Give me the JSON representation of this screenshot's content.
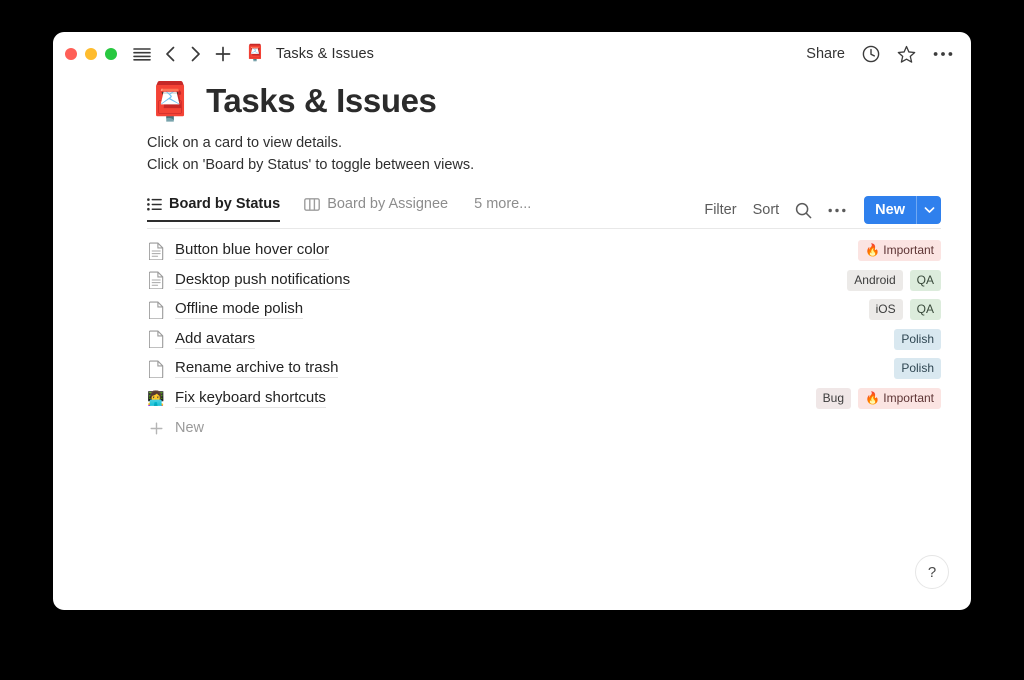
{
  "window": {
    "titlebar": {
      "title": "Tasks & Issues",
      "app_icon": "postbox-icon",
      "share_label": "Share",
      "icons": [
        "sidebar-toggle-icon",
        "back-chevron-icon",
        "forward-chevron-icon",
        "plus-icon"
      ],
      "right_icons": [
        "history-clock-icon",
        "star-icon",
        "more-options-icon"
      ]
    }
  },
  "page": {
    "emoji": "postbox-icon",
    "title": "Tasks & Issues",
    "subtitle_line_1": "Click on a card to view details.",
    "subtitle_line_2": "Click on 'Board by Status' to toggle between views."
  },
  "tabs": {
    "items": [
      {
        "label": "Board by Status",
        "icon": "list-view-icon",
        "active": true
      },
      {
        "label": "Board by Assignee",
        "icon": "board-view-icon",
        "active": false
      }
    ],
    "more_label": "5 more...",
    "tools": {
      "filter_label": "Filter",
      "sort_label": "Sort",
      "search_icon": "search-icon",
      "more_icon": "more-options-icon"
    },
    "new_button": {
      "label": "New",
      "caret_icon": "chevron-down-icon",
      "color": "#2f80ed"
    }
  },
  "task_list": {
    "rows": [
      {
        "icon": "page-with-lines-icon",
        "icon_type": "doc",
        "title": "Button blue hover color",
        "tags": [
          {
            "label": "🔥 Important",
            "color": "pink"
          }
        ]
      },
      {
        "icon": "page-with-lines-icon",
        "icon_type": "doc",
        "title": "Desktop push notifications",
        "tags": [
          {
            "label": "Android",
            "color": "gray"
          },
          {
            "label": "QA",
            "color": "green"
          }
        ]
      },
      {
        "icon": "blank-page-icon",
        "icon_type": "blank",
        "title": "Offline mode polish",
        "tags": [
          {
            "label": "iOS",
            "color": "gray"
          },
          {
            "label": "QA",
            "color": "green"
          }
        ]
      },
      {
        "icon": "blank-page-icon",
        "icon_type": "blank",
        "title": "Add avatars",
        "tags": [
          {
            "label": "Polish",
            "color": "blue"
          }
        ]
      },
      {
        "icon": "blank-page-icon",
        "icon_type": "blank",
        "title": "Rename archive to trash",
        "tags": [
          {
            "label": "Polish",
            "color": "blue"
          }
        ]
      },
      {
        "icon": "technologist-emoji-icon",
        "icon_type": "emoji",
        "emoji": "👩‍💻",
        "title": "Fix keyboard shortcuts",
        "tags": [
          {
            "label": "Bug",
            "color": "graypink"
          },
          {
            "label": "🔥 Important",
            "color": "pink"
          }
        ]
      }
    ],
    "new_row_label": "New"
  },
  "help": {
    "label": "?"
  },
  "colors": {
    "accent_blue": "#2f80ed",
    "tag_pink": "#fbe4e2",
    "tag_green": "#dcecdc",
    "tag_blue": "#d9e8f0",
    "tag_gray": "#eceae8",
    "traffic_red": "#ff5f57",
    "traffic_yellow": "#febc2e",
    "traffic_green": "#28c840"
  }
}
